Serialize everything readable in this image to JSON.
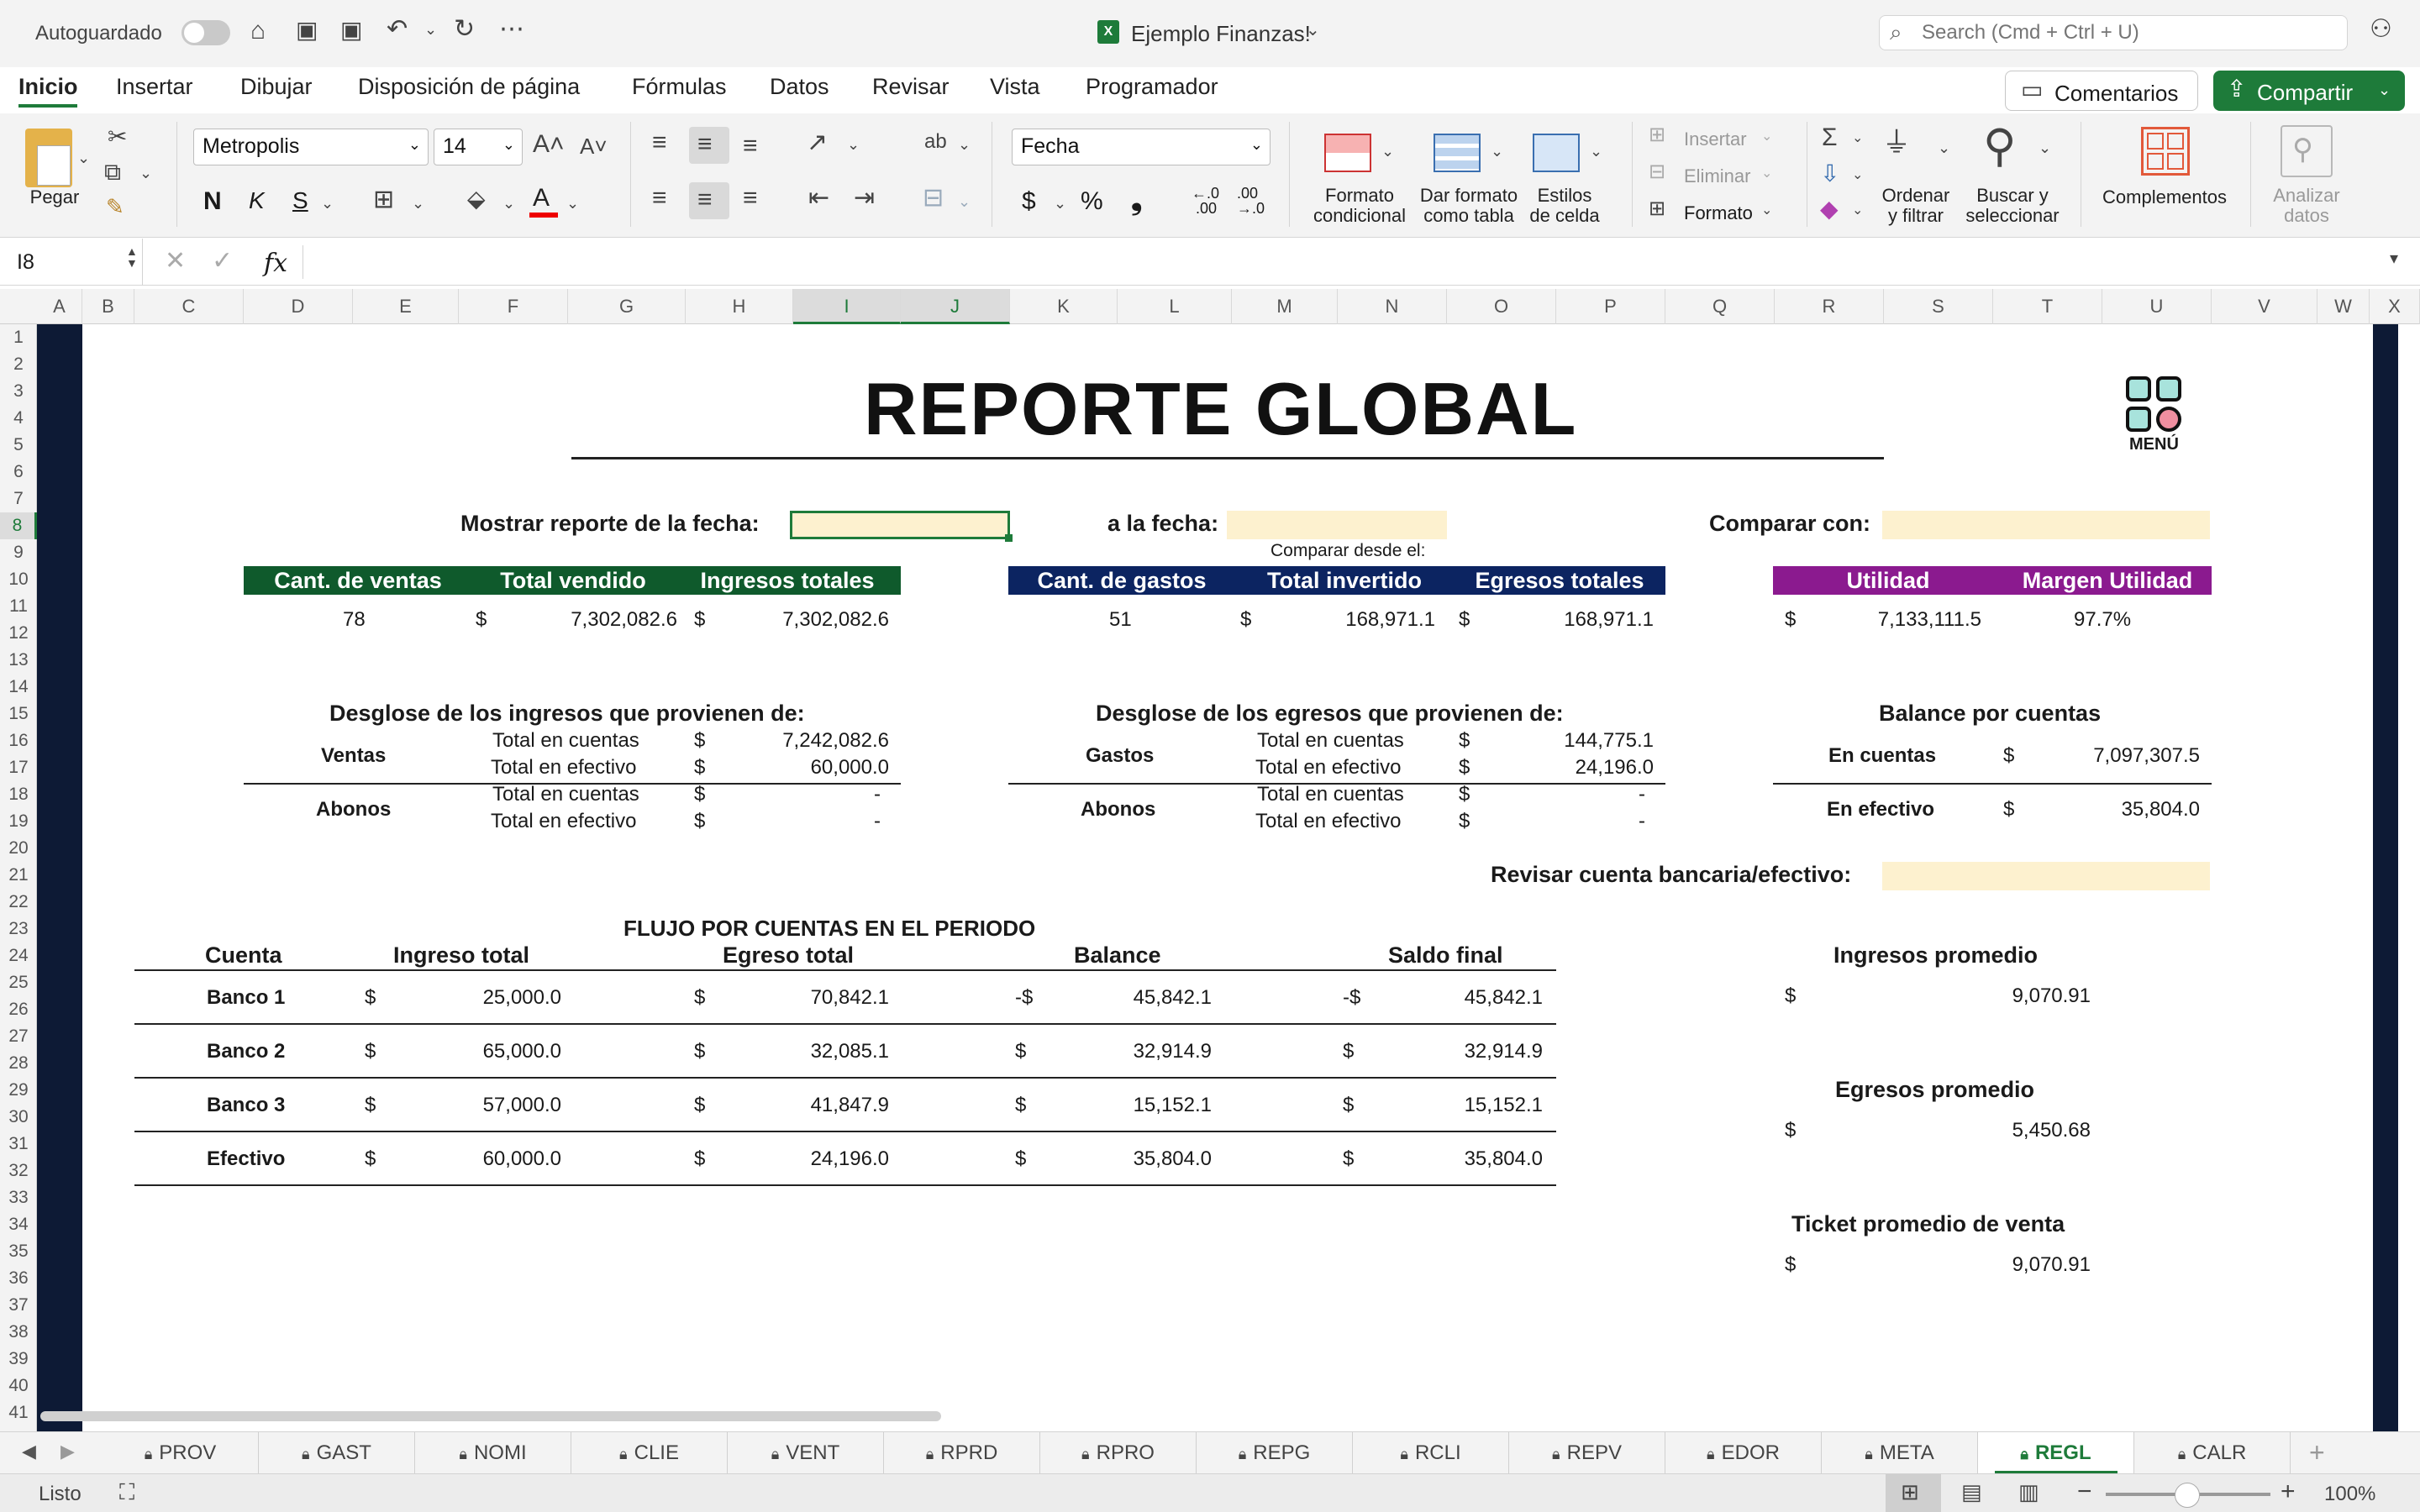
{
  "titlebar": {
    "autosave_label": "Autoguardado",
    "doc_title": "Ejemplo Finanzas!",
    "search_placeholder": "Search (Cmd + Ctrl + U)"
  },
  "menu_tabs": [
    "Inicio",
    "Insertar",
    "Dibujar",
    "Disposición de página",
    "Fórmulas",
    "Datos",
    "Revisar",
    "Vista",
    "Programador"
  ],
  "comments_label": "Comentarios",
  "share_label": "Compartir",
  "ribbon": {
    "paste": "Pegar",
    "font_name": "Metropolis",
    "font_size": "14",
    "number_format": "Fecha",
    "cond_format_1": "Formato",
    "cond_format_2": "condicional",
    "table_format_1": "Dar formato",
    "table_format_2": "como tabla",
    "cell_styles_1": "Estilos",
    "cell_styles_2": "de celda",
    "insert": "Insertar",
    "delete": "Eliminar",
    "format": "Formato",
    "sort_1": "Ordenar",
    "sort_2": "y filtrar",
    "find_1": "Buscar y",
    "find_2": "seleccionar",
    "addins": "Complementos",
    "analyze_1": "Analizar",
    "analyze_2": "datos",
    "bold": "N",
    "italic": "K",
    "underline": "S",
    "percent": "%",
    "dollar": "$",
    "comma": "❟",
    "inc_dec": ".0\n.00",
    "wrap": "ab"
  },
  "formula_bar": {
    "cell_ref": "I8",
    "fx": "fx"
  },
  "columns": [
    "A",
    "B",
    "C",
    "D",
    "E",
    "F",
    "G",
    "H",
    "I",
    "J",
    "K",
    "L",
    "M",
    "N",
    "O",
    "P",
    "Q",
    "R",
    "S",
    "T",
    "U",
    "V",
    "W",
    "X"
  ],
  "rows": [
    "1",
    "2",
    "3",
    "4",
    "5",
    "6",
    "7",
    "8",
    "9",
    "10",
    "11",
    "12",
    "13",
    "14",
    "15",
    "16",
    "17",
    "18",
    "19",
    "20",
    "21",
    "22",
    "23",
    "24",
    "25",
    "26",
    "27",
    "28",
    "29",
    "30",
    "31",
    "32",
    "33",
    "34",
    "35",
    "36",
    "37",
    "38",
    "39",
    "40",
    "41"
  ],
  "report": {
    "title": "REPORTE GLOBAL",
    "menu_label": "MENÚ",
    "show_from": "Mostrar reporte de la fecha:",
    "to_date": "a la fecha:",
    "compare_with": "Comparar con:",
    "compare_from": "Comparar desde el:",
    "income_headers": [
      "Cant. de ventas",
      "Total vendido",
      "Ingresos totales"
    ],
    "income_values": {
      "count": "78",
      "cur1": "$",
      "sold": "7,302,082.6",
      "cur2": "$",
      "total": "7,302,082.6"
    },
    "expense_headers": [
      "Cant. de gastos",
      "Total invertido",
      "Egresos totales"
    ],
    "expense_values": {
      "count": "51",
      "cur1": "$",
      "invested": "168,971.1",
      "cur2": "$",
      "total": "168,971.1"
    },
    "profit_headers": [
      "Utilidad",
      "Margen Utilidad"
    ],
    "profit_values": {
      "cur": "$",
      "profit": "7,133,111.5",
      "margin": "97.7%"
    },
    "income_breakdown": {
      "title": "Desglose de los ingresos que provienen de:",
      "g1": "Ventas",
      "g2": "Abonos",
      "l1": "Total en cuentas",
      "l2": "Total en efectivo",
      "l3": "Total en cuentas",
      "l4": "Total en efectivo",
      "c": "$",
      "v1": "7,242,082.6",
      "v2": "60,000.0",
      "v3": "-",
      "v4": "-"
    },
    "expense_breakdown": {
      "title": "Desglose de los egresos que provienen de:",
      "g1": "Gastos",
      "g2": "Abonos",
      "l1": "Total en cuentas",
      "l2": "Total en efectivo",
      "l3": "Total en cuentas",
      "l4": "Total en efectivo",
      "c": "$",
      "v1": "144,775.1",
      "v2": "24,196.0",
      "v3": "-",
      "v4": "-"
    },
    "balance": {
      "title": "Balance por cuentas",
      "l1": "En cuentas",
      "l2": "En efectivo",
      "c": "$",
      "v1": "7,097,307.5",
      "v2": "35,804.0"
    },
    "review": "Revisar cuenta bancaria/efectivo:",
    "flow": {
      "title": "FLUJO POR CUENTAS EN EL PERIODO",
      "headers": [
        "Cuenta",
        "Ingreso total",
        "Egreso total",
        "Balance",
        "Saldo final"
      ],
      "rows": [
        {
          "name": "Banco 1",
          "c1": "$",
          "ingreso": "25,000.0",
          "c2": "$",
          "egreso": "70,842.1",
          "c3": "-$",
          "balance": "45,842.1",
          "c4": "-$",
          "saldo": "45,842.1"
        },
        {
          "name": "Banco 2",
          "c1": "$",
          "ingreso": "65,000.0",
          "c2": "$",
          "egreso": "32,085.1",
          "c3": "$",
          "balance": "32,914.9",
          "c4": "$",
          "saldo": "32,914.9"
        },
        {
          "name": "Banco 3",
          "c1": "$",
          "ingreso": "57,000.0",
          "c2": "$",
          "egreso": "41,847.9",
          "c3": "$",
          "balance": "15,152.1",
          "c4": "$",
          "saldo": "15,152.1"
        },
        {
          "name": "Efectivo",
          "c1": "$",
          "ingreso": "60,000.0",
          "c2": "$",
          "egreso": "24,196.0",
          "c3": "$",
          "balance": "35,804.0",
          "c4": "$",
          "saldo": "35,804.0"
        }
      ]
    },
    "avg_income": {
      "title": "Ingresos promedio",
      "c": "$",
      "v": "9,070.91"
    },
    "avg_expense": {
      "title": "Egresos promedio",
      "c": "$",
      "v": "5,450.68"
    },
    "avg_ticket": {
      "title": "Ticket promedio de venta",
      "c": "$",
      "v": "9,070.91"
    }
  },
  "sheet_tabs": [
    "PROV",
    "GAST",
    "NOMI",
    "CLIE",
    "VENT",
    "RPRD",
    "RPRO",
    "REPG",
    "RCLI",
    "REPV",
    "EDOR",
    "META",
    "REGL",
    "CALR"
  ],
  "active_sheet": "REGL",
  "status": {
    "ready": "Listo",
    "zoom": "100%"
  },
  "colors": {
    "green": "#0f5a2c",
    "navy": "#0c2461",
    "purple": "#8b1a8f",
    "excel_green": "#1e7b3a",
    "yellow": "#fdf1cf"
  }
}
